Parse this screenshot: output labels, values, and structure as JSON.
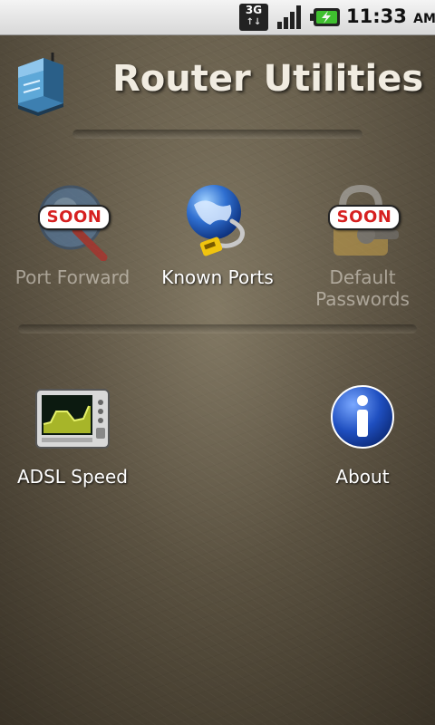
{
  "status_bar": {
    "network": "3G",
    "time": "11:33",
    "ampm": "AM"
  },
  "header": {
    "title": "Router Utilities"
  },
  "tiles": [
    {
      "label": "Port Forward",
      "badge": "SOON",
      "enabled": false
    },
    {
      "label": "Known Ports",
      "badge": "",
      "enabled": true
    },
    {
      "label": "Default\nPasswords",
      "badge": "SOON",
      "enabled": false
    },
    {
      "label": "ADSL Speed",
      "badge": "",
      "enabled": true
    },
    {
      "label": "About",
      "badge": "",
      "enabled": true
    }
  ],
  "colors": {
    "title": "#f1ece1",
    "badge_text": "#d62020",
    "background": "#5a4f40"
  }
}
